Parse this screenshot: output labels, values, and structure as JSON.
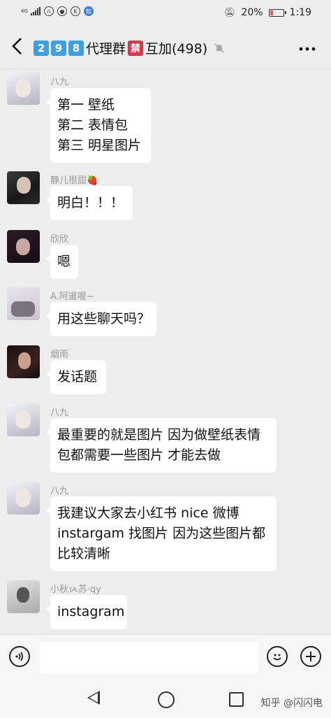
{
  "status_bar": {
    "network": "4G",
    "battery": "20%",
    "time": "1:19",
    "icon_k": "K",
    "icon_zhi": "知"
  },
  "header": {
    "title_digits": [
      "2",
      "9",
      "8"
    ],
    "title_text": "代理群",
    "ban_glyph": "禁",
    "title_suffix": "互加(498)"
  },
  "messages": [
    {
      "name": "八九",
      "avatar": "white-haired-girl",
      "lines": [
        "第一 壁纸",
        "第二 表情包",
        "第三 明星图片"
      ]
    },
    {
      "name": "静儿很甜🍓",
      "avatar": "dark-haired-girl",
      "lines": [
        "明白！！！"
      ]
    },
    {
      "name": "欣欣",
      "avatar": "dark-haired-girl-2",
      "lines": [
        "嗯"
      ]
    },
    {
      "name": "A.阿暹喔~",
      "avatar": "light-photo",
      "lines": [
        "用这些聊天吗？"
      ]
    },
    {
      "name": "烟雨",
      "avatar": "dark-photo",
      "lines": [
        "发话题"
      ]
    },
    {
      "name": "八九",
      "avatar": "white-haired-girl",
      "lines": [
        "最重要的就是图片 因为做壁纸表情",
        "包都需要一些图片 才能去做"
      ]
    },
    {
      "name": "八九",
      "avatar": "white-haired-girl",
      "lines": [
        "我建议大家去小红书 nice 微博",
        "instargam 找图片 因为这些图片都",
        "比较清晰"
      ]
    },
    {
      "name": "小秋ᝰ苏·qy",
      "avatar": "gray-photo",
      "lines": [
        "instagram"
      ]
    }
  ],
  "input_bar": {
    "voice_icon": "voice-icon",
    "emoji_icon": "emoji-icon",
    "plus_icon": "plus-icon",
    "text_value": ""
  },
  "nav_bar": {
    "watermark": "知乎 @闪闪电"
  }
}
